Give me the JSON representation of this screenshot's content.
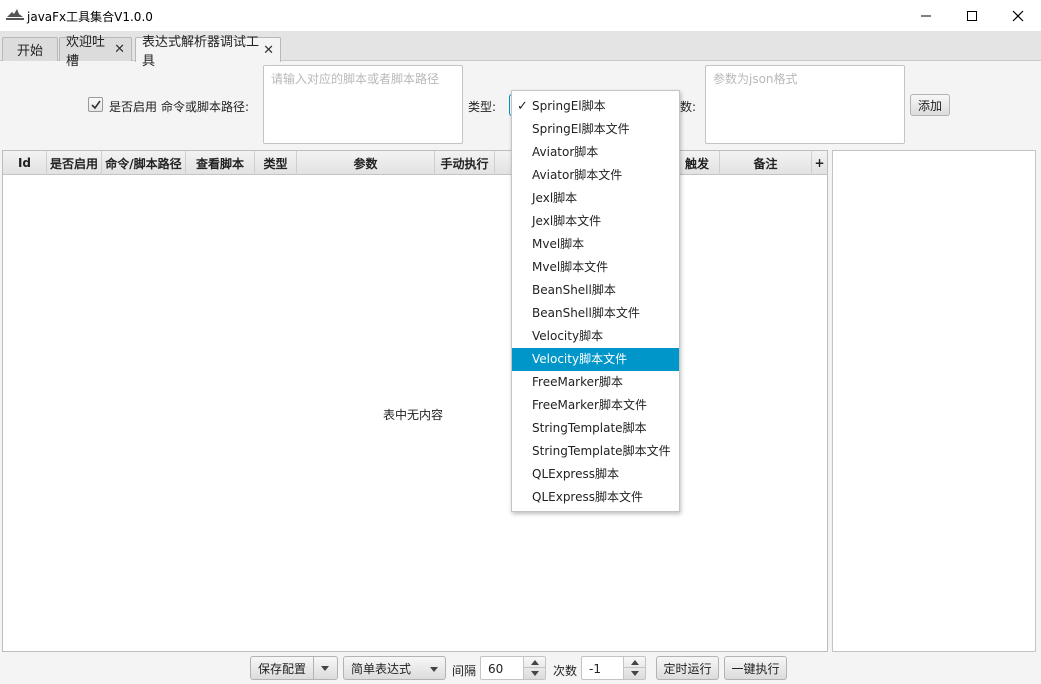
{
  "window": {
    "title": "javaFx工具集合V1.0.0",
    "icon": "java-cup-icon",
    "controls": [
      "minimize-icon",
      "maximize-icon",
      "close-icon"
    ]
  },
  "tabs": [
    {
      "label": "开始",
      "closable": false
    },
    {
      "label": "欢迎吐槽",
      "closable": true
    },
    {
      "label": "表达式解析器调试工具",
      "closable": true,
      "active": true
    }
  ],
  "form": {
    "enabled_label": "是否启用",
    "enabled_checked": true,
    "path_label": "命令或脚本路径:",
    "path_placeholder": "请输入对应的脚本或者脚本路径",
    "type_label": "类型:",
    "params_label_partial": "数:",
    "params_placeholder": "参数为json格式",
    "add_button": "添加"
  },
  "table": {
    "columns": [
      "Id",
      "是否启用",
      "命令/脚本路径",
      "查看脚本",
      "类型",
      "参数",
      "手动执行",
      "触发",
      "备注"
    ],
    "add_column_icon": "+",
    "empty_text": "表中无内容"
  },
  "type_dropdown": {
    "checked_item": "SpringEl脚本",
    "highlighted_item": "Velocity脚本文件",
    "items": [
      "SpringEl脚本",
      "SpringEl脚本文件",
      "Aviator脚本",
      "Aviator脚本文件",
      "Jexl脚本",
      "Jexl脚本文件",
      "Mvel脚本",
      "Mvel脚本文件",
      "BeanShell脚本",
      "BeanShell脚本文件",
      "Velocity脚本",
      "Velocity脚本文件",
      "FreeMarker脚本",
      "FreeMarker脚本文件",
      "StringTemplate脚本",
      "StringTemplate脚本文件",
      "QLExpress脚本",
      "QLExpress脚本文件"
    ]
  },
  "footer": {
    "save_config": "保存配置",
    "expression_mode": "简单表达式",
    "interval_label": "间隔",
    "interval_value": "60",
    "count_label": "次数",
    "count_value": "-1",
    "scheduled_run": "定时运行",
    "run_all": "一键执行"
  },
  "colors": {
    "accent": "#0096c9",
    "placeholder": "#b8b8b8"
  }
}
